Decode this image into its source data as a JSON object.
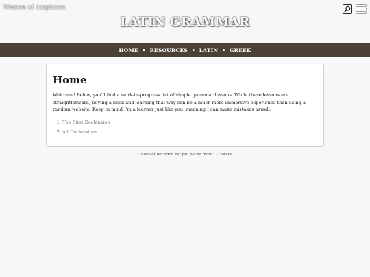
{
  "header": {
    "site_name": "Women of Amphissa",
    "title": "LATIN GRAMMAR",
    "search_icon": "search-icon",
    "menu_icon": "hamburger-menu-icon"
  },
  "nav": {
    "items": [
      "HOME",
      "RESOURCES",
      "LATIN",
      "GREEK"
    ],
    "separator": "•"
  },
  "main": {
    "heading": "Home",
    "intro": "Welcome! Below, you'll find a work-in-progress list of simple grammar lessons. While these lessons are straightforward, buying a book and learning that way can be a much more immersive experience than using a random website. Keep in mind I'm a learner just like you, meaning I can make mistakes aswell.",
    "links": [
      "The First Declension",
      "All Declensions"
    ]
  },
  "footer": {
    "quote": "\"Dulce et decorum est pro patria mori.\" - Horace"
  },
  "colors": {
    "nav_bg": "#4d4035",
    "page_bg": "#f7f7f9",
    "link": "#777777"
  }
}
